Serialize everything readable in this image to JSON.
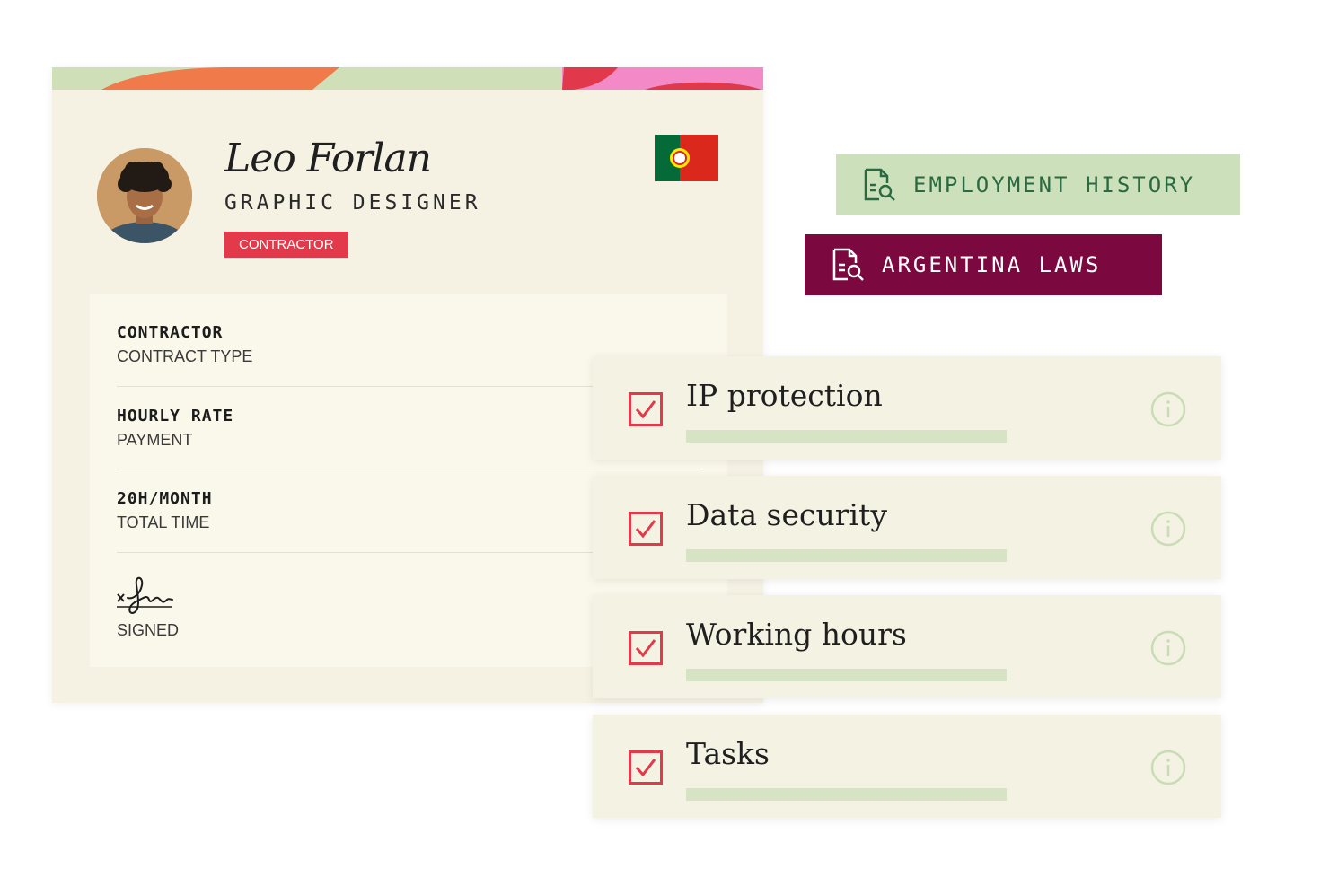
{
  "profile": {
    "name": "Leo Forlan",
    "job_title": "GRAPHIC DESIGNER",
    "badge": "CONTRACTOR",
    "flag_icon": "portugal-flag-icon",
    "details": [
      {
        "value": "CONTRACTOR",
        "label": "CONTRACT TYPE"
      },
      {
        "value": "HOURLY RATE",
        "label": "PAYMENT"
      },
      {
        "value": "20H/MONTH",
        "label": "TOTAL TIME"
      }
    ],
    "signature_label": "SIGNED"
  },
  "tags": {
    "employment_history": "EMPLOYMENT HISTORY",
    "argentina_laws": "ARGENTINA LAWS"
  },
  "checklist": [
    {
      "title": "IP protection",
      "checked": true
    },
    {
      "title": "Data security",
      "checked": true
    },
    {
      "title": "Working hours",
      "checked": true
    },
    {
      "title": "Tasks",
      "checked": true
    }
  ],
  "colors": {
    "accent_red": "#e23a4b",
    "tag_green_bg": "#cde0bc",
    "tag_green_text": "#2a6a40",
    "tag_maroon_bg": "#7b0940",
    "card_bg": "#f5f2e4"
  }
}
